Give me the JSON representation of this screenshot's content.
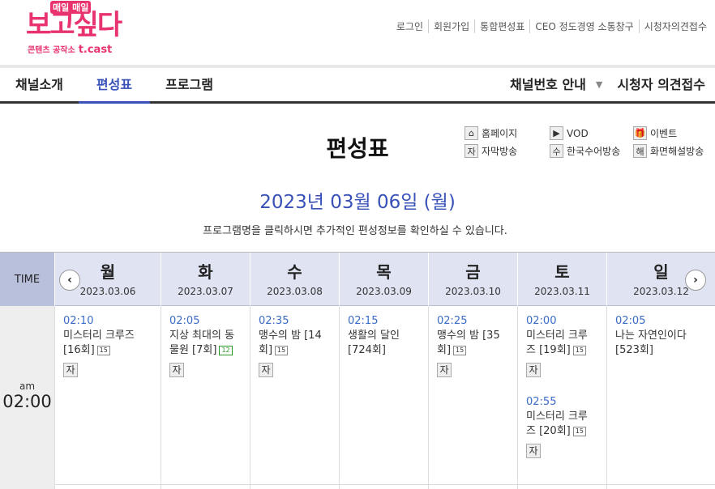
{
  "logo": {
    "top_badge": "매일 매일",
    "main": "보고싶다",
    "sub": "콘텐츠 공작소",
    "brand": "t.cast"
  },
  "util_links": [
    "로그인",
    "회원가입",
    "통합편성표",
    "CEO 정도경영 소통창구",
    "시청자의견접수"
  ],
  "gnb": {
    "items": [
      "채널소개",
      "편성표",
      "프로그램"
    ],
    "active": 1,
    "right1": "채널번호 안내",
    "right2": "시청자 의견접수"
  },
  "page_title": "편성표",
  "legend": [
    {
      "icon": "home-icon",
      "glyph": "⌂",
      "label": "홈페이지"
    },
    {
      "icon": "vod-icon",
      "glyph": "▶",
      "label": "VOD"
    },
    {
      "icon": "event-icon",
      "glyph": "🎁",
      "label": "이벤트"
    },
    {
      "icon": "subtitle-icon",
      "glyph": "자",
      "label": "자막방송"
    },
    {
      "icon": "sign-language-icon",
      "glyph": "수",
      "label": "한국수어방송"
    },
    {
      "icon": "audio-description-icon",
      "glyph": "해",
      "label": "화면해설방송"
    }
  ],
  "date_heading": "2023년 03월 06일 (월)",
  "notice": "프로그램명을 클릭하시면 추가적인 편성정보를 확인하실 수 있습니다.",
  "table": {
    "time_header": "TIME",
    "prev": "‹",
    "next": "›",
    "days": [
      {
        "name": "월",
        "date": "2023.03.06"
      },
      {
        "name": "화",
        "date": "2023.03.07"
      },
      {
        "name": "수",
        "date": "2023.03.08"
      },
      {
        "name": "목",
        "date": "2023.03.09"
      },
      {
        "name": "금",
        "date": "2023.03.10"
      },
      {
        "name": "토",
        "date": "2023.03.11"
      },
      {
        "name": "일",
        "date": "2023.03.12"
      }
    ],
    "slot": {
      "ampm": "am",
      "time": "02:00"
    },
    "programs": [
      [
        {
          "time": "02:10",
          "l1": "미스터리 크루즈",
          "l2": "[16회]",
          "rating": "15",
          "sub": "자"
        }
      ],
      [
        {
          "time": "02:05",
          "l1": "지상 최대의 동",
          "l2": "물원 [7회]",
          "rating": "12",
          "sub": "자"
        }
      ],
      [
        {
          "time": "02:35",
          "l1": "맹수의 밤 [14",
          "l2": "회]",
          "rating": "15",
          "sub": "자"
        }
      ],
      [
        {
          "time": "02:15",
          "l1": "생활의 달인",
          "l2": "[724회]",
          "rating": "",
          "sub": ""
        }
      ],
      [
        {
          "time": "02:25",
          "l1": "맹수의 밤 [35",
          "l2": "회]",
          "rating": "15",
          "sub": "자"
        }
      ],
      [
        {
          "time": "02:00",
          "l1": "미스터리 크루",
          "l2": "즈 [19회]",
          "rating": "15",
          "sub": "자"
        },
        {
          "time": "02:55",
          "l1": "미스터리 크루",
          "l2": "즈 [20회]",
          "rating": "15",
          "sub": "자"
        }
      ],
      [
        {
          "time": "02:05",
          "l1": "나는 자연인이다",
          "l2": "[523회]",
          "rating": "",
          "sub": ""
        }
      ]
    ]
  }
}
